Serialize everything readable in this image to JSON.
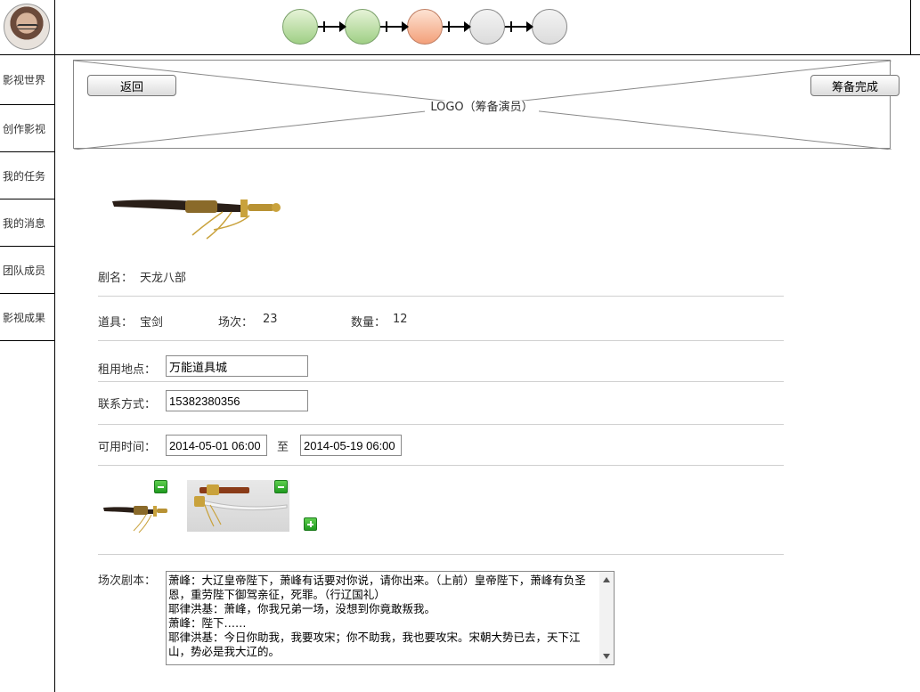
{
  "sidebar": {
    "items": [
      {
        "label": "影视世界"
      },
      {
        "label": "创作影视"
      },
      {
        "label": "我的任务"
      },
      {
        "label": "我的消息"
      },
      {
        "label": "团队成员"
      },
      {
        "label": "影视成果"
      }
    ]
  },
  "steps": {
    "total": 5,
    "completed": 2,
    "current": 3
  },
  "banner": {
    "back_label": "返回",
    "logo_text": "LOGO（筹备演员）",
    "done_label": "筹备完成"
  },
  "details": {
    "title_label": "剧名：",
    "title_value": "天龙八部",
    "prop_label": "道具：",
    "prop_value": "宝剑",
    "scene_label": "场次：",
    "scene_value": "23",
    "quantity_label": "数量：",
    "quantity_value": "12",
    "rental_label": "租用地点：",
    "rental_value": "万能道具城",
    "contact_label": "联系方式：",
    "contact_value": "15382380356",
    "time_label": "可用时间：",
    "time_start": "2014-05-01  06:00",
    "time_sep": "至",
    "time_end": "2014-05-19  06:00",
    "script_label": "场次剧本：",
    "script_text": "萧峰：大辽皇帝陛下，萧峰有话要对你说，请你出来。（上前）皇帝陛下，萧峰有负圣恩，重劳陛下御驾亲征，死罪。（行辽国礼）\n耶律洪基：萧峰，你我兄弟一场，没想到你竟敢叛我。\n萧峰：陛下……\n耶律洪基：今日你助我，我要攻宋；你不助我，我也要攻宋。宋朝大势已去，天下江山，势必是我大辽的。"
  },
  "colors": {
    "step_done": "#9fcf85",
    "step_active": "#f3a07a",
    "step_pending": "#dcdcdc",
    "icon_green": "#1f9a1f"
  }
}
